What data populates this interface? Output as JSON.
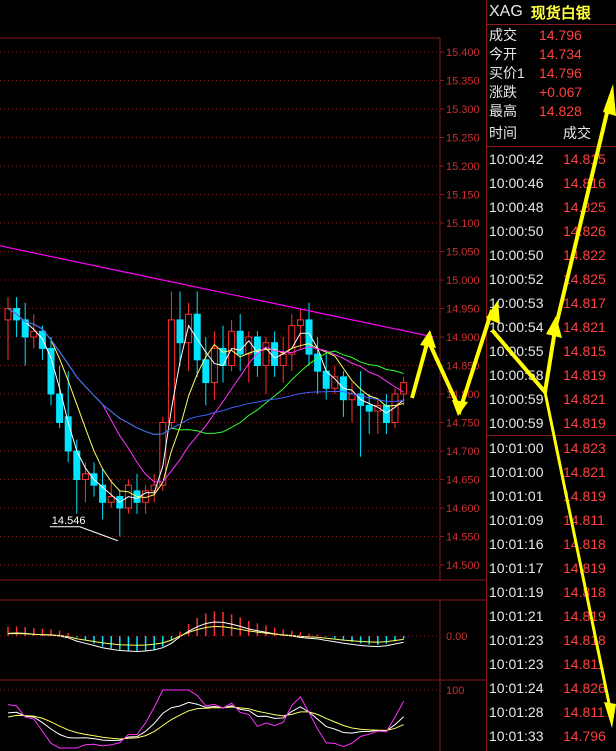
{
  "instrument": {
    "symbol": "XAG",
    "name": "现货白银"
  },
  "quote": [
    {
      "label": "成交",
      "value": "14.796"
    },
    {
      "label": "今开",
      "value": "14.734"
    },
    {
      "label": "买价1",
      "value": "14.796"
    },
    {
      "label": "涨跌",
      "value": "+0.067"
    },
    {
      "label": "最高",
      "value": "14.828"
    }
  ],
  "ticks_header": {
    "time": "时间",
    "price": "成交"
  },
  "ticks": [
    {
      "time": "10:00:42",
      "price": "14.815"
    },
    {
      "time": "10:00:46",
      "price": "14.816"
    },
    {
      "time": "10:00:48",
      "price": "14.825"
    },
    {
      "time": "10:00:50",
      "price": "14.826"
    },
    {
      "time": "10:00:50",
      "price": "14.822"
    },
    {
      "time": "10:00:52",
      "price": "14.825"
    },
    {
      "time": "10:00:53",
      "price": "14.817"
    },
    {
      "time": "10:00:54",
      "price": "14.821"
    },
    {
      "time": "10:00:55",
      "price": "14.815"
    },
    {
      "time": "10:00:58",
      "price": "14.819"
    },
    {
      "time": "10:00:59",
      "price": "14.821"
    },
    {
      "time": "10:00:59",
      "price": "14.819"
    },
    {
      "time": "10:01:00",
      "price": "14.823"
    },
    {
      "time": "10:01:00",
      "price": "14.821"
    },
    {
      "time": "10:01:01",
      "price": "14.819"
    },
    {
      "time": "10:01:09",
      "price": "14.811"
    },
    {
      "time": "10:01:16",
      "price": "14.818"
    },
    {
      "time": "10:01:17",
      "price": "14.819"
    },
    {
      "time": "10:01:19",
      "price": "14.818"
    },
    {
      "time": "10:01:21",
      "price": "14.819"
    },
    {
      "time": "10:01:23",
      "price": "14.818"
    },
    {
      "time": "10:01:23",
      "price": "14.811"
    },
    {
      "time": "10:01:24",
      "price": "14.826"
    },
    {
      "time": "10:01:28",
      "price": "14.811"
    },
    {
      "time": "10:01:33",
      "price": "14.796"
    }
  ],
  "chart_data": {
    "type": "candlestick",
    "price_axis": {
      "range": [
        14.475,
        15.425
      ],
      "ticks": [
        "15.400",
        "15.350",
        "15.300",
        "15.250",
        "15.200",
        "15.150",
        "15.100",
        "15.050",
        "15.000",
        "14.950",
        "14.900",
        "14.850",
        "14.800",
        "14.750",
        "14.700",
        "14.650",
        "14.600",
        "14.550",
        "14.500"
      ]
    },
    "low_annotation": "14.546",
    "candles": [
      {
        "o": 14.93,
        "h": 14.97,
        "l": 14.86,
        "c": 14.95
      },
      {
        "o": 14.95,
        "h": 14.97,
        "l": 14.9,
        "c": 14.93
      },
      {
        "o": 14.93,
        "h": 14.96,
        "l": 14.85,
        "c": 14.9
      },
      {
        "o": 14.9,
        "h": 14.94,
        "l": 14.88,
        "c": 14.91
      },
      {
        "o": 14.91,
        "h": 14.92,
        "l": 14.86,
        "c": 14.88
      },
      {
        "o": 14.88,
        "h": 14.9,
        "l": 14.78,
        "c": 14.8
      },
      {
        "o": 14.8,
        "h": 14.85,
        "l": 14.74,
        "c": 14.75
      },
      {
        "o": 14.76,
        "h": 14.84,
        "l": 14.68,
        "c": 14.7
      },
      {
        "o": 14.7,
        "h": 14.72,
        "l": 14.59,
        "c": 14.65
      },
      {
        "o": 14.65,
        "h": 14.68,
        "l": 14.61,
        "c": 14.66
      },
      {
        "o": 14.66,
        "h": 14.68,
        "l": 14.62,
        "c": 14.64
      },
      {
        "o": 14.64,
        "h": 14.67,
        "l": 14.58,
        "c": 14.61
      },
      {
        "o": 14.61,
        "h": 14.65,
        "l": 14.6,
        "c": 14.62
      },
      {
        "o": 14.62,
        "h": 14.63,
        "l": 14.55,
        "c": 14.6
      },
      {
        "o": 14.6,
        "h": 14.65,
        "l": 14.59,
        "c": 14.64
      },
      {
        "o": 14.63,
        "h": 14.66,
        "l": 14.59,
        "c": 14.61
      },
      {
        "o": 14.61,
        "h": 14.64,
        "l": 14.59,
        "c": 14.63
      },
      {
        "o": 14.63,
        "h": 14.66,
        "l": 14.61,
        "c": 14.64
      },
      {
        "o": 14.64,
        "h": 14.76,
        "l": 14.63,
        "c": 14.75
      },
      {
        "o": 14.75,
        "h": 14.98,
        "l": 14.74,
        "c": 14.93
      },
      {
        "o": 14.93,
        "h": 14.98,
        "l": 14.85,
        "c": 14.89
      },
      {
        "o": 14.89,
        "h": 14.96,
        "l": 14.84,
        "c": 14.94
      },
      {
        "o": 14.94,
        "h": 14.98,
        "l": 14.83,
        "c": 14.86
      },
      {
        "o": 14.86,
        "h": 14.9,
        "l": 14.78,
        "c": 14.82
      },
      {
        "o": 14.82,
        "h": 14.91,
        "l": 14.79,
        "c": 14.88
      },
      {
        "o": 14.88,
        "h": 14.92,
        "l": 14.82,
        "c": 14.85
      },
      {
        "o": 14.85,
        "h": 14.93,
        "l": 14.84,
        "c": 14.91
      },
      {
        "o": 14.91,
        "h": 14.94,
        "l": 14.84,
        "c": 14.87
      },
      {
        "o": 14.87,
        "h": 14.91,
        "l": 14.82,
        "c": 14.9
      },
      {
        "o": 14.9,
        "h": 14.91,
        "l": 14.83,
        "c": 14.85
      },
      {
        "o": 14.85,
        "h": 14.9,
        "l": 14.8,
        "c": 14.89
      },
      {
        "o": 14.89,
        "h": 14.91,
        "l": 14.83,
        "c": 14.85
      },
      {
        "o": 14.85,
        "h": 14.9,
        "l": 14.82,
        "c": 14.87
      },
      {
        "o": 14.87,
        "h": 14.94,
        "l": 14.84,
        "c": 14.92
      },
      {
        "o": 14.92,
        "h": 14.95,
        "l": 14.88,
        "c": 14.93
      },
      {
        "o": 14.93,
        "h": 14.96,
        "l": 14.85,
        "c": 14.87
      },
      {
        "o": 14.87,
        "h": 14.9,
        "l": 14.8,
        "c": 14.84
      },
      {
        "o": 14.84,
        "h": 14.87,
        "l": 14.79,
        "c": 14.81
      },
      {
        "o": 14.81,
        "h": 14.85,
        "l": 14.8,
        "c": 14.83
      },
      {
        "o": 14.83,
        "h": 14.84,
        "l": 14.76,
        "c": 14.79
      },
      {
        "o": 14.79,
        "h": 14.82,
        "l": 14.75,
        "c": 14.8
      },
      {
        "o": 14.8,
        "h": 14.84,
        "l": 14.69,
        "c": 14.78
      },
      {
        "o": 14.78,
        "h": 14.8,
        "l": 14.73,
        "c": 14.77
      },
      {
        "o": 14.77,
        "h": 14.79,
        "l": 14.73,
        "c": 14.78
      },
      {
        "o": 14.78,
        "h": 14.8,
        "l": 14.73,
        "c": 14.75
      },
      {
        "o": 14.75,
        "h": 14.81,
        "l": 14.74,
        "c": 14.8
      },
      {
        "o": 14.8,
        "h": 14.83,
        "l": 14.78,
        "c": 14.82
      }
    ],
    "macd_axis_label": "0.00",
    "macd_histogram": [
      0.3,
      0.32,
      0.3,
      0.26,
      0.24,
      0.22,
      0.18,
      0.1,
      -0.05,
      -0.15,
      -0.25,
      -0.35,
      -0.42,
      -0.48,
      -0.5,
      -0.52,
      -0.5,
      -0.45,
      -0.35,
      -0.15,
      0.15,
      0.4,
      0.6,
      0.75,
      0.82,
      0.8,
      0.72,
      0.62,
      0.5,
      0.42,
      0.35,
      0.28,
      0.22,
      0.18,
      0.12,
      0.08,
      0.05,
      -0.02,
      -0.08,
      -0.15,
      -0.2,
      -0.25,
      -0.28,
      -0.3,
      -0.26,
      -0.18,
      -0.1
    ],
    "kdj_axis_label": "100",
    "colors": {
      "up": "#ff3030",
      "down": "#00e5ff",
      "grid": "#8a1a1a",
      "trendline": "#ff00ff"
    }
  }
}
